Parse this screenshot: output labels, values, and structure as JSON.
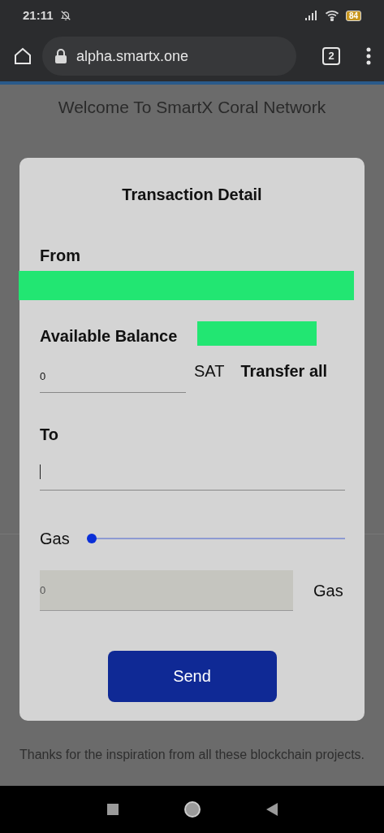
{
  "status_bar": {
    "time": "21:11",
    "battery": "84"
  },
  "browser": {
    "url": "alpha.smartx.one",
    "tab_count": "2"
  },
  "page": {
    "heading": "Welcome To SmartX Coral Network",
    "footer": "Thanks for the inspiration from all these blockchain projects."
  },
  "dialog": {
    "title": "Transaction Detail",
    "from": {
      "label": "From",
      "redacted": true
    },
    "balance": {
      "label": "Available Balance",
      "redacted": true
    },
    "amount": {
      "value": "0",
      "unit": "SAT",
      "transfer_all": "Transfer all"
    },
    "to": {
      "label": "To",
      "focused": true
    },
    "gas": {
      "label": "Gas",
      "level": 0,
      "value": "0",
      "unit": "Gas"
    },
    "send": "Send"
  }
}
